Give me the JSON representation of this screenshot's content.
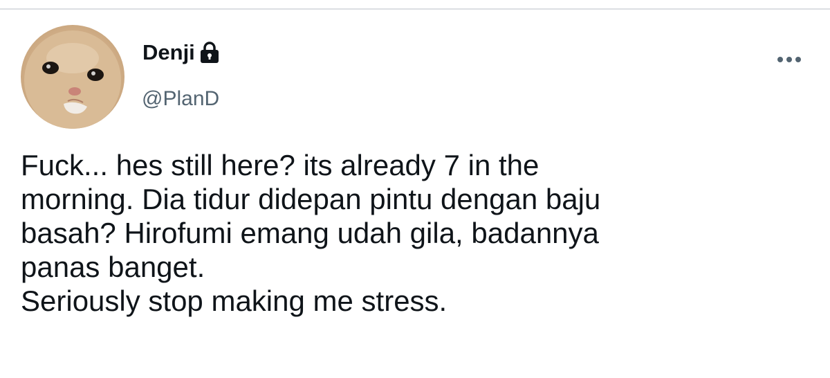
{
  "tweet": {
    "author": {
      "display_name": "Denji",
      "handle": "@PlanD",
      "avatar_icon": "kitten-avatar",
      "protected_icon": "lock-icon"
    },
    "more_icon": "more-dots-icon",
    "text": "Fuck... hes still here? its already 7 in the\nmorning. Dia tidur didepan pintu dengan baju\nbasah? Hirofumi emang udah gila, badannya\npanas banget.\nSeriously stop making me stress."
  },
  "colors": {
    "text_primary": "#0f1419",
    "text_secondary": "#536471",
    "divider": "#dcdfe3"
  }
}
